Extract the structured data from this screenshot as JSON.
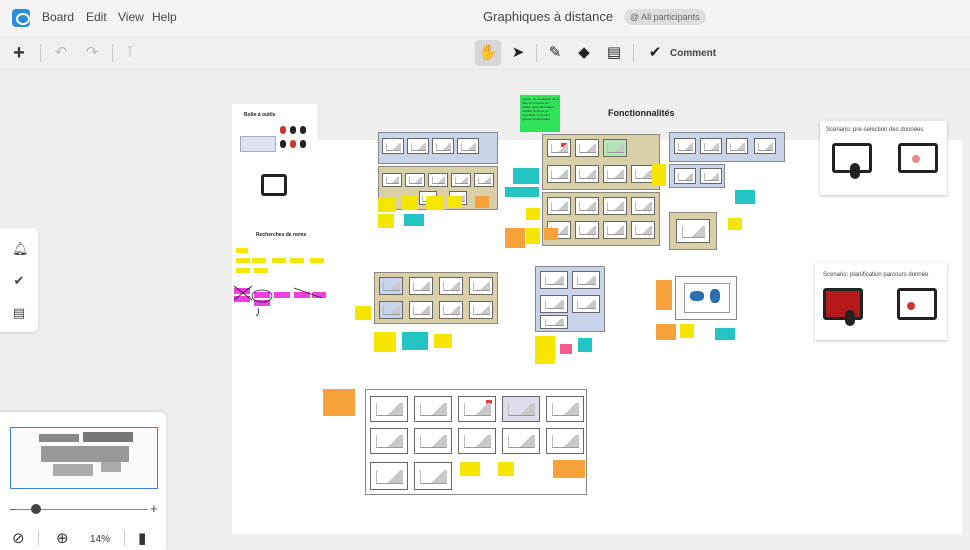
{
  "menubar": {
    "menus": [
      "Board",
      "Edit",
      "View",
      "Help"
    ],
    "title": "Graphiques à distance",
    "participants_badge": "@ All participants"
  },
  "toolbar": {
    "add": "add-icon",
    "undo": "undo-icon",
    "redo": "redo-icon",
    "format_painter": "paint-roller-icon",
    "hand": "hand-icon",
    "select": "pointer-icon",
    "pen": "pen-icon",
    "eraser": "eraser-icon",
    "note": "note-icon",
    "comment_label": "Comment",
    "active_tool": "hand"
  },
  "sidepanel": {
    "items": [
      "bell-icon",
      "check-circle-icon",
      "document-icon"
    ]
  },
  "navigator": {
    "zoom_level": "14%",
    "zoom_minus": "–",
    "zoom_plus": "+",
    "compass": "compass-icon",
    "zoom": "zoom-in-icon",
    "mouse": "mouse-icon"
  },
  "board": {
    "toolbox_title": "Boîte à outils",
    "recherches_title": "Recherches de noms",
    "center_title": "Fonctionnalités",
    "green_note": "A faire : se renseigner sur le live code\nfaire un scenario sur\nvérifier ajout information,\nmodifier donnée, et\nconsolider ce dernier\ngrande fonctionnalité",
    "scenario1": "Scenario: pre-selection des données",
    "scenario2": "Scenario: planification parcours donnée"
  },
  "colors": {
    "accent": "#2a8fd8",
    "sticky_yellow": "#f6e500",
    "sticky_orange": "#f7a13b",
    "sticky_green": "#2fe25a",
    "sticky_teal": "#24c4c4",
    "sticky_magenta": "#ee3fe0"
  }
}
